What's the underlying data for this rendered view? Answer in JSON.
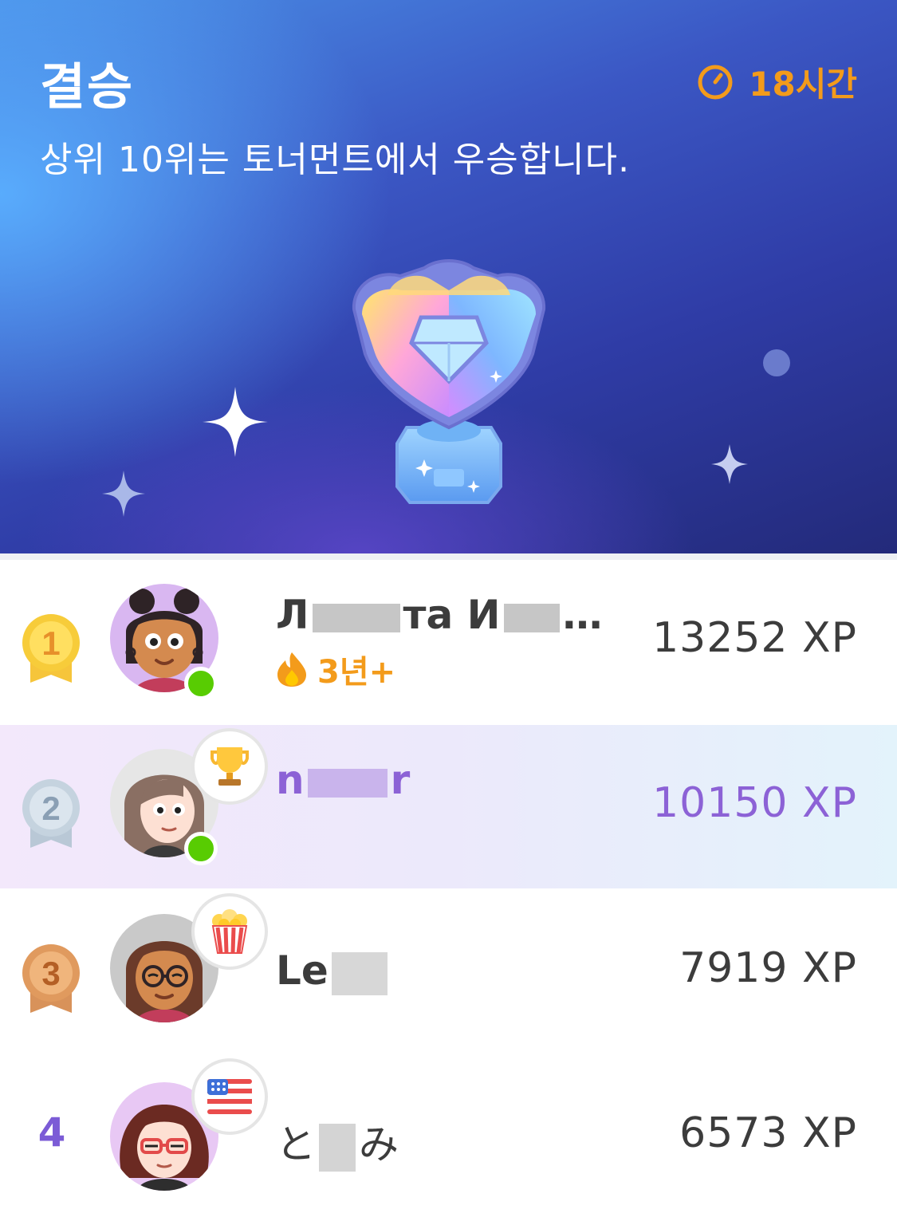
{
  "header": {
    "title": "결승",
    "subtitle": "상위 10위는 토너먼트에서 우승합니다.",
    "timer": "18시간",
    "trophy_icon": "diamond-trophy-icon"
  },
  "colors": {
    "accent_orange": "#f39b1b",
    "current_user_purple": "#8c62d6",
    "online_green": "#58cc02"
  },
  "leaderboard": [
    {
      "rank": "1",
      "name_start": "Л",
      "name_mid": "та И",
      "name_end": "…",
      "streak": "3년+",
      "xp": "13252 XP",
      "online": true,
      "medal": "gold"
    },
    {
      "rank": "2",
      "name_start": "n",
      "name_mid": "",
      "name_end": "r",
      "xp": "10150 XP",
      "online": true,
      "medal": "silver",
      "badge_icon": "trophy-icon",
      "is_current_user": true
    },
    {
      "rank": "3",
      "name_start": "Le",
      "name_mid": "",
      "name_end": "",
      "xp": "7919 XP",
      "online": false,
      "medal": "bronze",
      "badge_icon": "popcorn-icon"
    },
    {
      "rank": "4",
      "name_start": "と",
      "name_mid": "",
      "name_end": "み",
      "xp": "6573 XP",
      "online": false,
      "badge_icon": "us-flag-icon"
    }
  ]
}
